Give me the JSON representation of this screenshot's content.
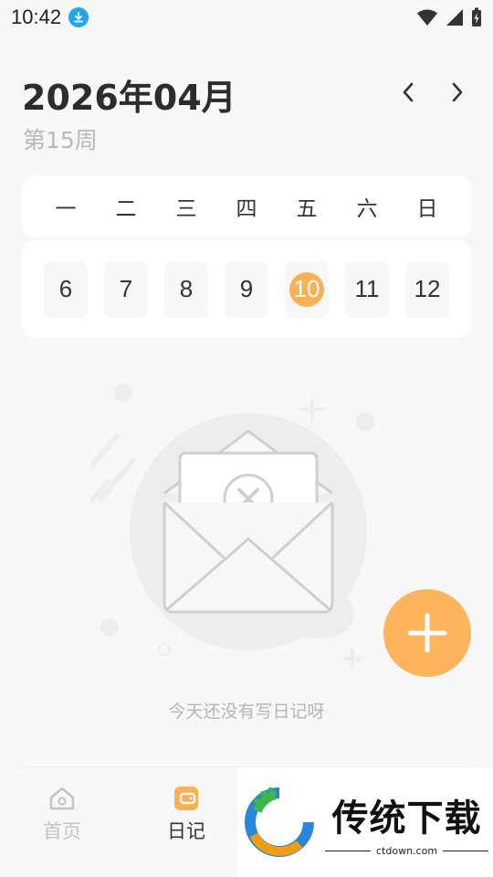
{
  "status_bar": {
    "time": "10:42",
    "icons": [
      "download-icon",
      "wifi-icon",
      "signal-icon",
      "battery-charging-icon"
    ]
  },
  "header": {
    "month_title": "2026年04月",
    "week_label": "第15周",
    "prev_icon": "chevron-left-icon",
    "next_icon": "chevron-right-icon"
  },
  "week": {
    "weekdays": [
      "一",
      "二",
      "三",
      "四",
      "五",
      "六",
      "日"
    ],
    "dates": [
      "6",
      "7",
      "8",
      "9",
      "10",
      "11",
      "12"
    ],
    "selected_date": "10"
  },
  "empty_state": {
    "message": "今天还没有写日记呀",
    "illustration": "empty-envelope-icon"
  },
  "fab": {
    "icon": "plus-icon"
  },
  "bottom_nav": {
    "items": [
      {
        "label": "首页",
        "icon": "home-icon",
        "active": false
      },
      {
        "label": "日记",
        "icon": "diary-icon",
        "active": true
      }
    ]
  },
  "watermark": {
    "title": "传统下载",
    "subtitle": "ctdown.com"
  },
  "colors": {
    "accent": "#fbb055",
    "background": "#f7f7f7",
    "card": "#ffffff",
    "muted_text": "#b8b8b8"
  }
}
